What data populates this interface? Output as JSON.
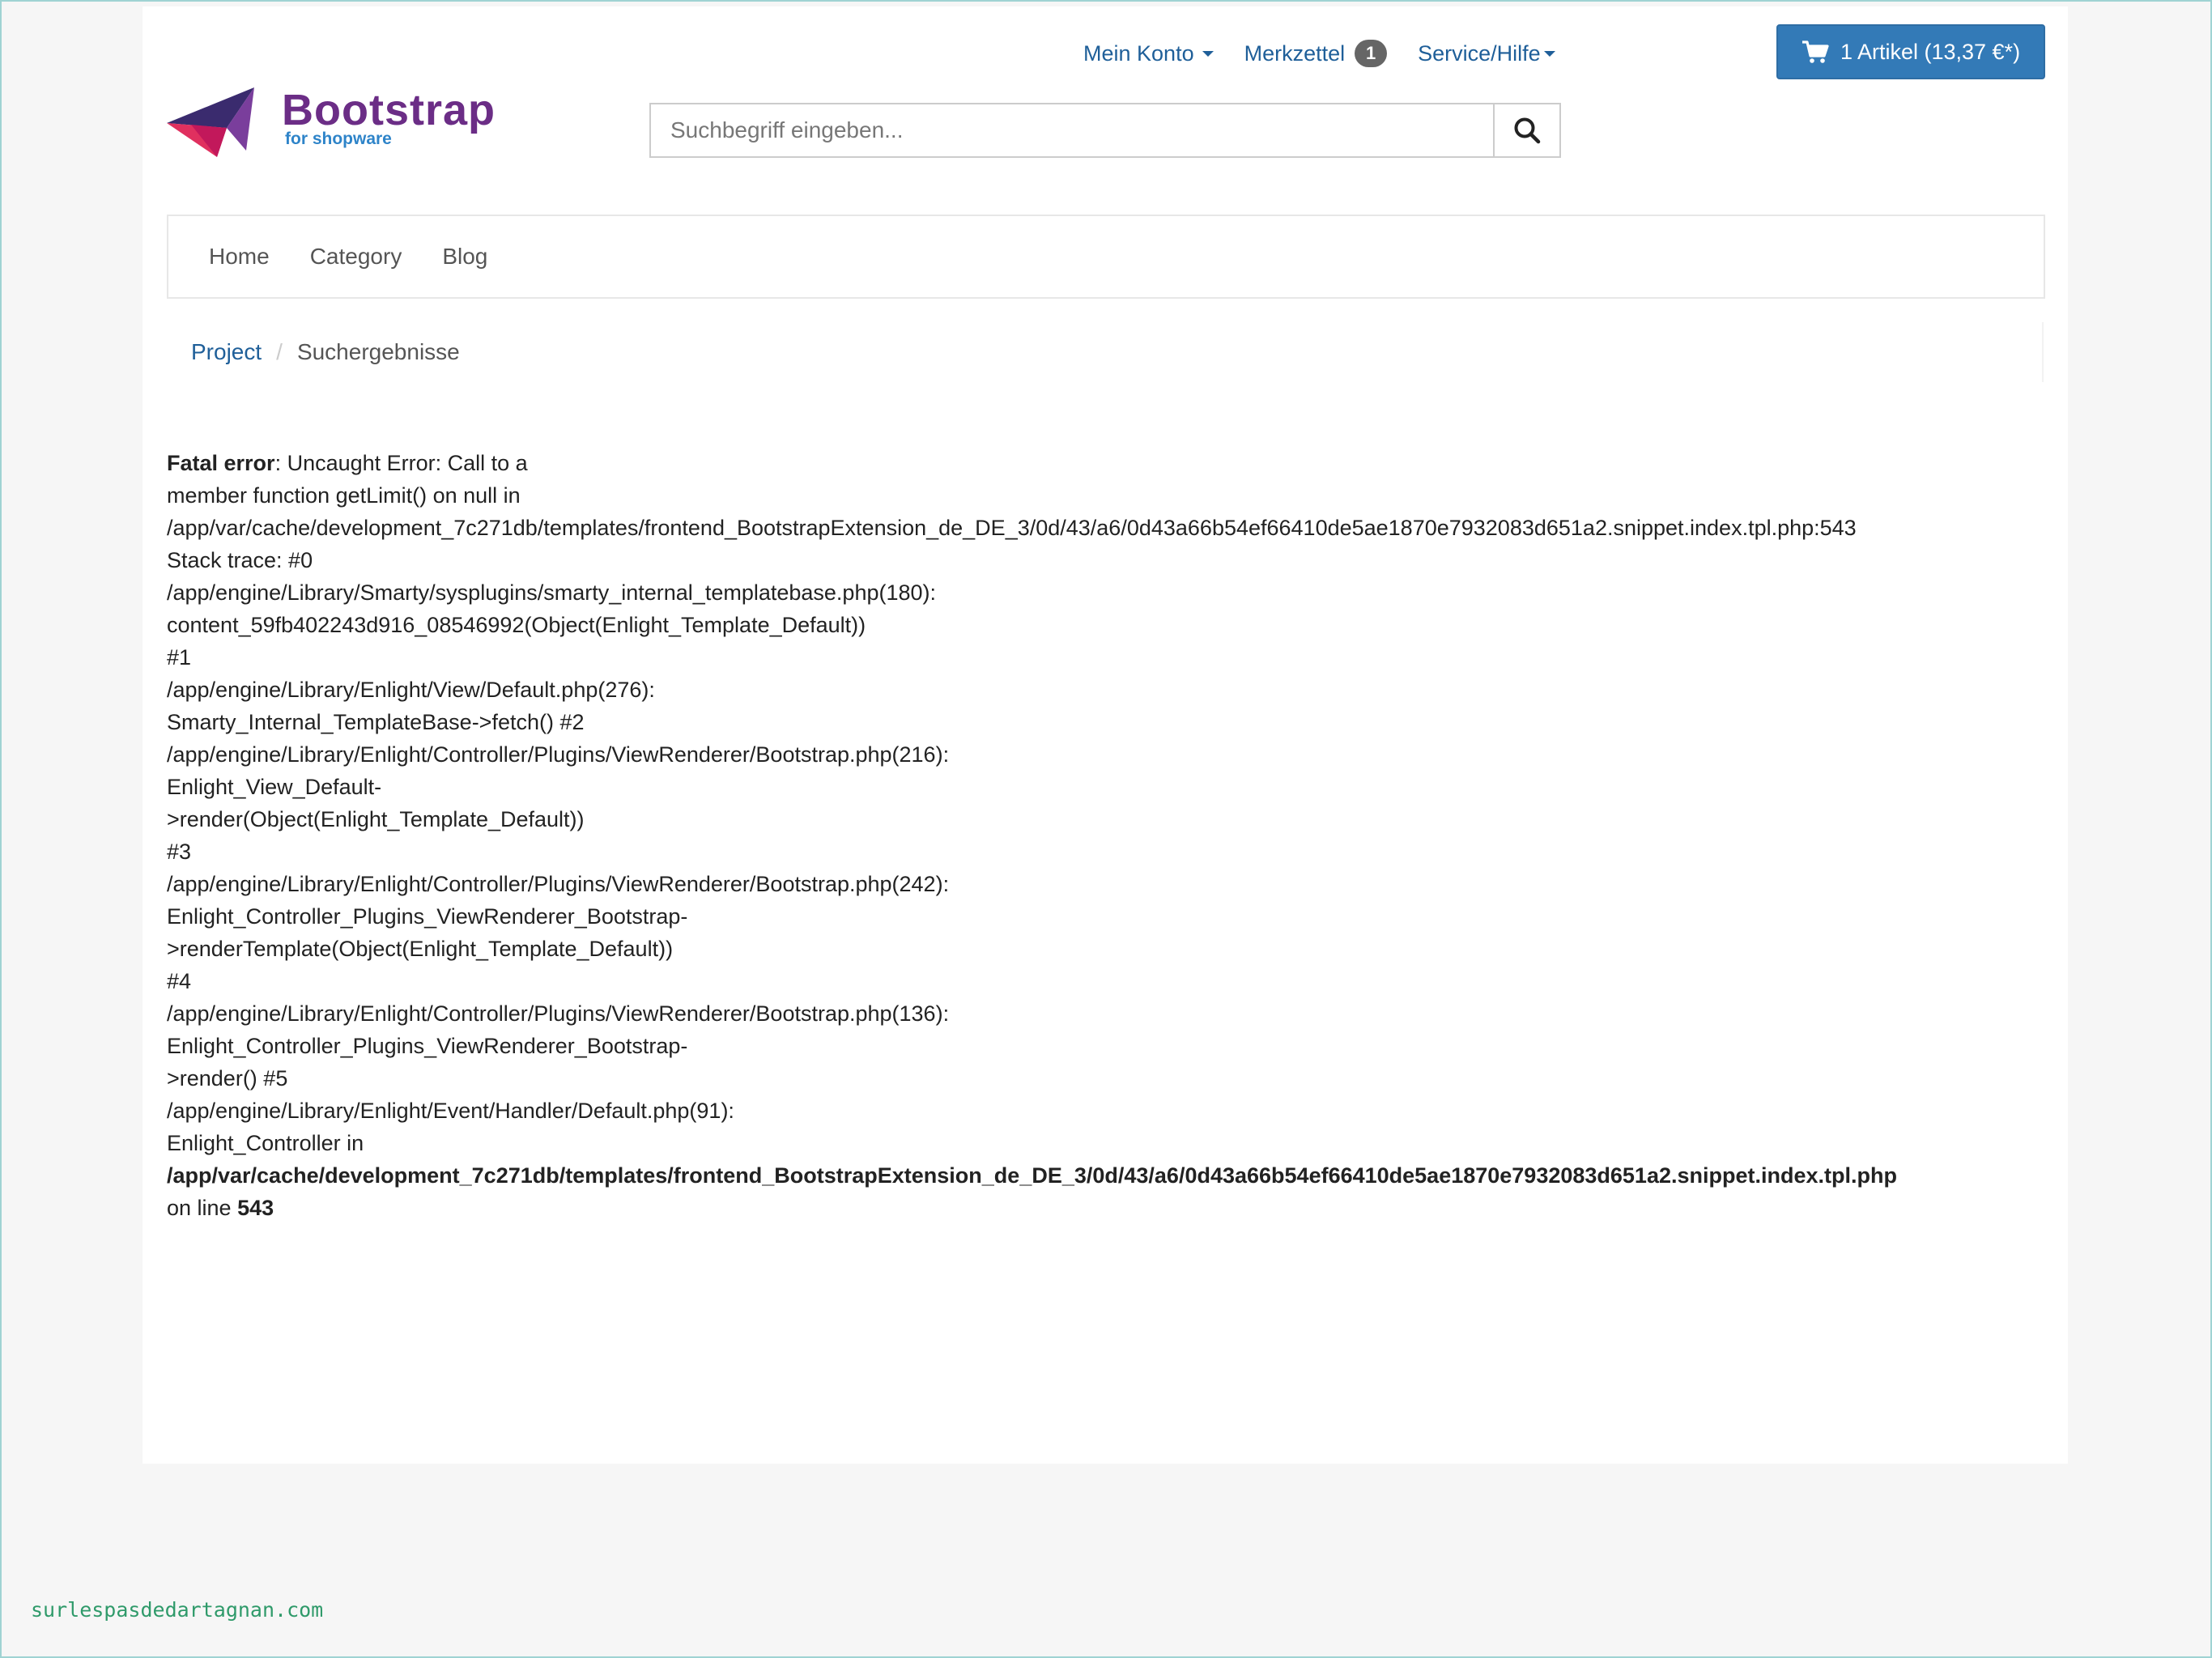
{
  "header": {
    "my_account": "Mein Konto",
    "wishlist": "Merkzettel",
    "wishlist_count": "1",
    "service": "Service/Hilfe",
    "cart_label": "1 Artikel (13,37 €*)"
  },
  "logo": {
    "word": "Bootstrap",
    "sub": "for shopware"
  },
  "search": {
    "placeholder": "Suchbegriff eingeben..."
  },
  "nav": {
    "items": [
      "Home",
      "Category",
      "Blog"
    ]
  },
  "breadcrumb": {
    "root": "Project",
    "separator": "/",
    "current": "Suchergebnisse"
  },
  "error": {
    "title": "Fatal error",
    "l1_rest": ": Uncaught Error: Call to a",
    "l2": "member function getLimit() on null in",
    "l3": "/app/var/cache/development_7c271db/templates/frontend_BootstrapExtension_de_DE_3/0d/43/a6/0d43a66b54ef66410de5ae1870e7932083d651a2.snippet.index.tpl.php:543",
    "l4": "Stack trace: #0",
    "l5": "/app/engine/Library/Smarty/sysplugins/smarty_internal_templatebase.php(180):",
    "l6": "content_59fb402243d916_08546992(Object(Enlight_Template_Default))",
    "l7": "#1",
    "l8": "/app/engine/Library/Enlight/View/Default.php(276):",
    "l9": "Smarty_Internal_TemplateBase->fetch() #2",
    "l10": "/app/engine/Library/Enlight/Controller/Plugins/ViewRenderer/Bootstrap.php(216):",
    "l11": "Enlight_View_Default-",
    "l12": ">render(Object(Enlight_Template_Default))",
    "l13": "#3",
    "l14": "/app/engine/Library/Enlight/Controller/Plugins/ViewRenderer/Bootstrap.php(242):",
    "l15": "Enlight_Controller_Plugins_ViewRenderer_Bootstrap-",
    "l16": ">renderTemplate(Object(Enlight_Template_Default))",
    "l17": "#4",
    "l18": "/app/engine/Library/Enlight/Controller/Plugins/ViewRenderer/Bootstrap.php(136):",
    "l19": "Enlight_Controller_Plugins_ViewRenderer_Bootstrap-",
    "l20": ">render() #5",
    "l21": "/app/engine/Library/Enlight/Event/Handler/Default.php(91):",
    "l22": "Enlight_Controller in",
    "l23": "/app/var/cache/development_7c271db/templates/frontend_BootstrapExtension_de_DE_3/0d/43/a6/0d43a66b54ef66410de5ae1870e7932083d651a2.snippet.index.tpl.php",
    "l24_pre": "on line ",
    "line_number": "543"
  },
  "watermark": "surlespasdedartagnan.com",
  "colors": {
    "link": "#1f5f99",
    "cart": "#337ab7",
    "logo_purple": "#6b2d86",
    "logo_blue": "#2e84c9"
  },
  "icons": {
    "cart": "shopping-cart-icon",
    "search": "search-icon",
    "logo": "paper-plane-logo"
  }
}
